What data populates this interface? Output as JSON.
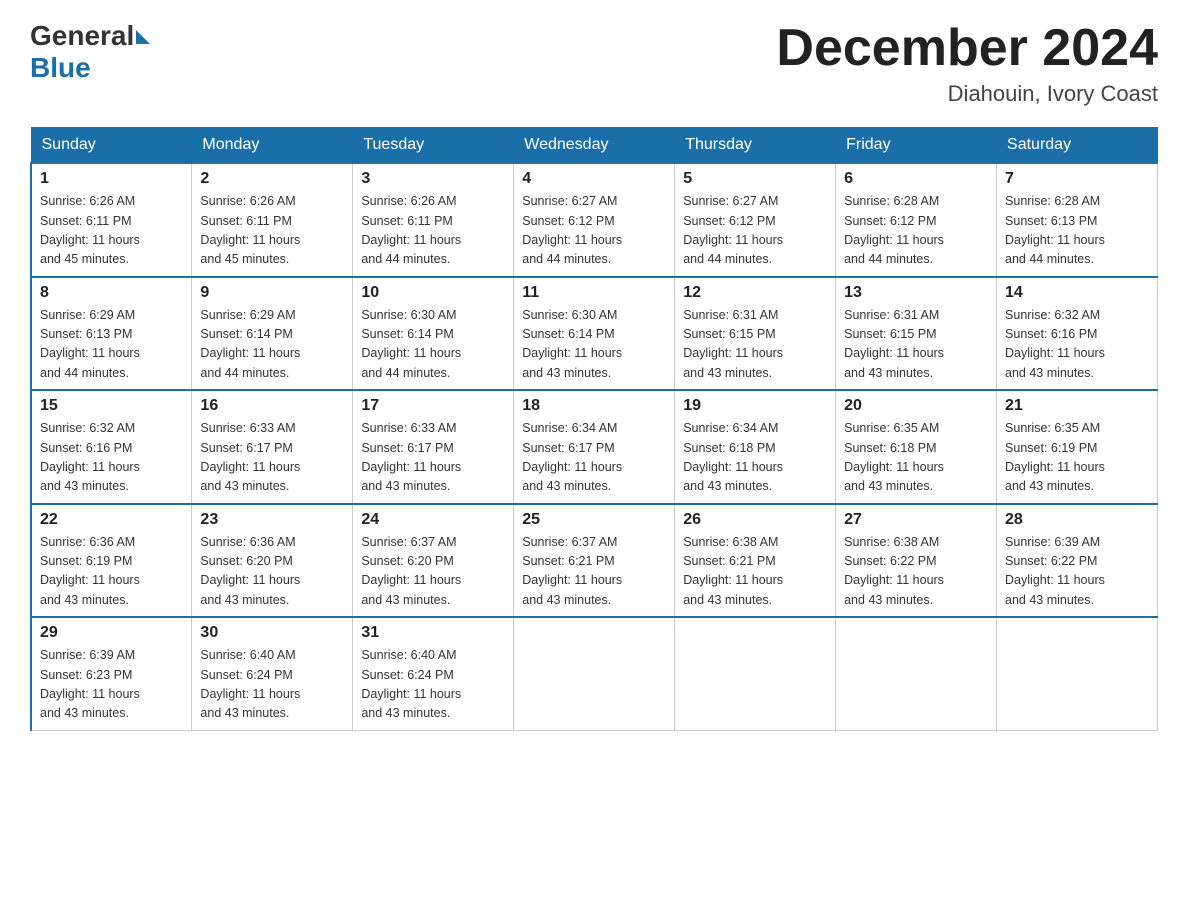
{
  "header": {
    "logo_general": "General",
    "logo_blue": "Blue",
    "month_title": "December 2024",
    "location": "Diahouin, Ivory Coast"
  },
  "weekdays": [
    "Sunday",
    "Monday",
    "Tuesday",
    "Wednesday",
    "Thursday",
    "Friday",
    "Saturday"
  ],
  "weeks": [
    [
      {
        "day": "1",
        "sunrise": "6:26 AM",
        "sunset": "6:11 PM",
        "daylight": "11 hours and 45 minutes."
      },
      {
        "day": "2",
        "sunrise": "6:26 AM",
        "sunset": "6:11 PM",
        "daylight": "11 hours and 45 minutes."
      },
      {
        "day": "3",
        "sunrise": "6:26 AM",
        "sunset": "6:11 PM",
        "daylight": "11 hours and 44 minutes."
      },
      {
        "day": "4",
        "sunrise": "6:27 AM",
        "sunset": "6:12 PM",
        "daylight": "11 hours and 44 minutes."
      },
      {
        "day": "5",
        "sunrise": "6:27 AM",
        "sunset": "6:12 PM",
        "daylight": "11 hours and 44 minutes."
      },
      {
        "day": "6",
        "sunrise": "6:28 AM",
        "sunset": "6:12 PM",
        "daylight": "11 hours and 44 minutes."
      },
      {
        "day": "7",
        "sunrise": "6:28 AM",
        "sunset": "6:13 PM",
        "daylight": "11 hours and 44 minutes."
      }
    ],
    [
      {
        "day": "8",
        "sunrise": "6:29 AM",
        "sunset": "6:13 PM",
        "daylight": "11 hours and 44 minutes."
      },
      {
        "day": "9",
        "sunrise": "6:29 AM",
        "sunset": "6:14 PM",
        "daylight": "11 hours and 44 minutes."
      },
      {
        "day": "10",
        "sunrise": "6:30 AM",
        "sunset": "6:14 PM",
        "daylight": "11 hours and 44 minutes."
      },
      {
        "day": "11",
        "sunrise": "6:30 AM",
        "sunset": "6:14 PM",
        "daylight": "11 hours and 43 minutes."
      },
      {
        "day": "12",
        "sunrise": "6:31 AM",
        "sunset": "6:15 PM",
        "daylight": "11 hours and 43 minutes."
      },
      {
        "day": "13",
        "sunrise": "6:31 AM",
        "sunset": "6:15 PM",
        "daylight": "11 hours and 43 minutes."
      },
      {
        "day": "14",
        "sunrise": "6:32 AM",
        "sunset": "6:16 PM",
        "daylight": "11 hours and 43 minutes."
      }
    ],
    [
      {
        "day": "15",
        "sunrise": "6:32 AM",
        "sunset": "6:16 PM",
        "daylight": "11 hours and 43 minutes."
      },
      {
        "day": "16",
        "sunrise": "6:33 AM",
        "sunset": "6:17 PM",
        "daylight": "11 hours and 43 minutes."
      },
      {
        "day": "17",
        "sunrise": "6:33 AM",
        "sunset": "6:17 PM",
        "daylight": "11 hours and 43 minutes."
      },
      {
        "day": "18",
        "sunrise": "6:34 AM",
        "sunset": "6:17 PM",
        "daylight": "11 hours and 43 minutes."
      },
      {
        "day": "19",
        "sunrise": "6:34 AM",
        "sunset": "6:18 PM",
        "daylight": "11 hours and 43 minutes."
      },
      {
        "day": "20",
        "sunrise": "6:35 AM",
        "sunset": "6:18 PM",
        "daylight": "11 hours and 43 minutes."
      },
      {
        "day": "21",
        "sunrise": "6:35 AM",
        "sunset": "6:19 PM",
        "daylight": "11 hours and 43 minutes."
      }
    ],
    [
      {
        "day": "22",
        "sunrise": "6:36 AM",
        "sunset": "6:19 PM",
        "daylight": "11 hours and 43 minutes."
      },
      {
        "day": "23",
        "sunrise": "6:36 AM",
        "sunset": "6:20 PM",
        "daylight": "11 hours and 43 minutes."
      },
      {
        "day": "24",
        "sunrise": "6:37 AM",
        "sunset": "6:20 PM",
        "daylight": "11 hours and 43 minutes."
      },
      {
        "day": "25",
        "sunrise": "6:37 AM",
        "sunset": "6:21 PM",
        "daylight": "11 hours and 43 minutes."
      },
      {
        "day": "26",
        "sunrise": "6:38 AM",
        "sunset": "6:21 PM",
        "daylight": "11 hours and 43 minutes."
      },
      {
        "day": "27",
        "sunrise": "6:38 AM",
        "sunset": "6:22 PM",
        "daylight": "11 hours and 43 minutes."
      },
      {
        "day": "28",
        "sunrise": "6:39 AM",
        "sunset": "6:22 PM",
        "daylight": "11 hours and 43 minutes."
      }
    ],
    [
      {
        "day": "29",
        "sunrise": "6:39 AM",
        "sunset": "6:23 PM",
        "daylight": "11 hours and 43 minutes."
      },
      {
        "day": "30",
        "sunrise": "6:40 AM",
        "sunset": "6:24 PM",
        "daylight": "11 hours and 43 minutes."
      },
      {
        "day": "31",
        "sunrise": "6:40 AM",
        "sunset": "6:24 PM",
        "daylight": "11 hours and 43 minutes."
      },
      null,
      null,
      null,
      null
    ]
  ],
  "labels": {
    "sunrise": "Sunrise:",
    "sunset": "Sunset:",
    "daylight": "Daylight:"
  }
}
